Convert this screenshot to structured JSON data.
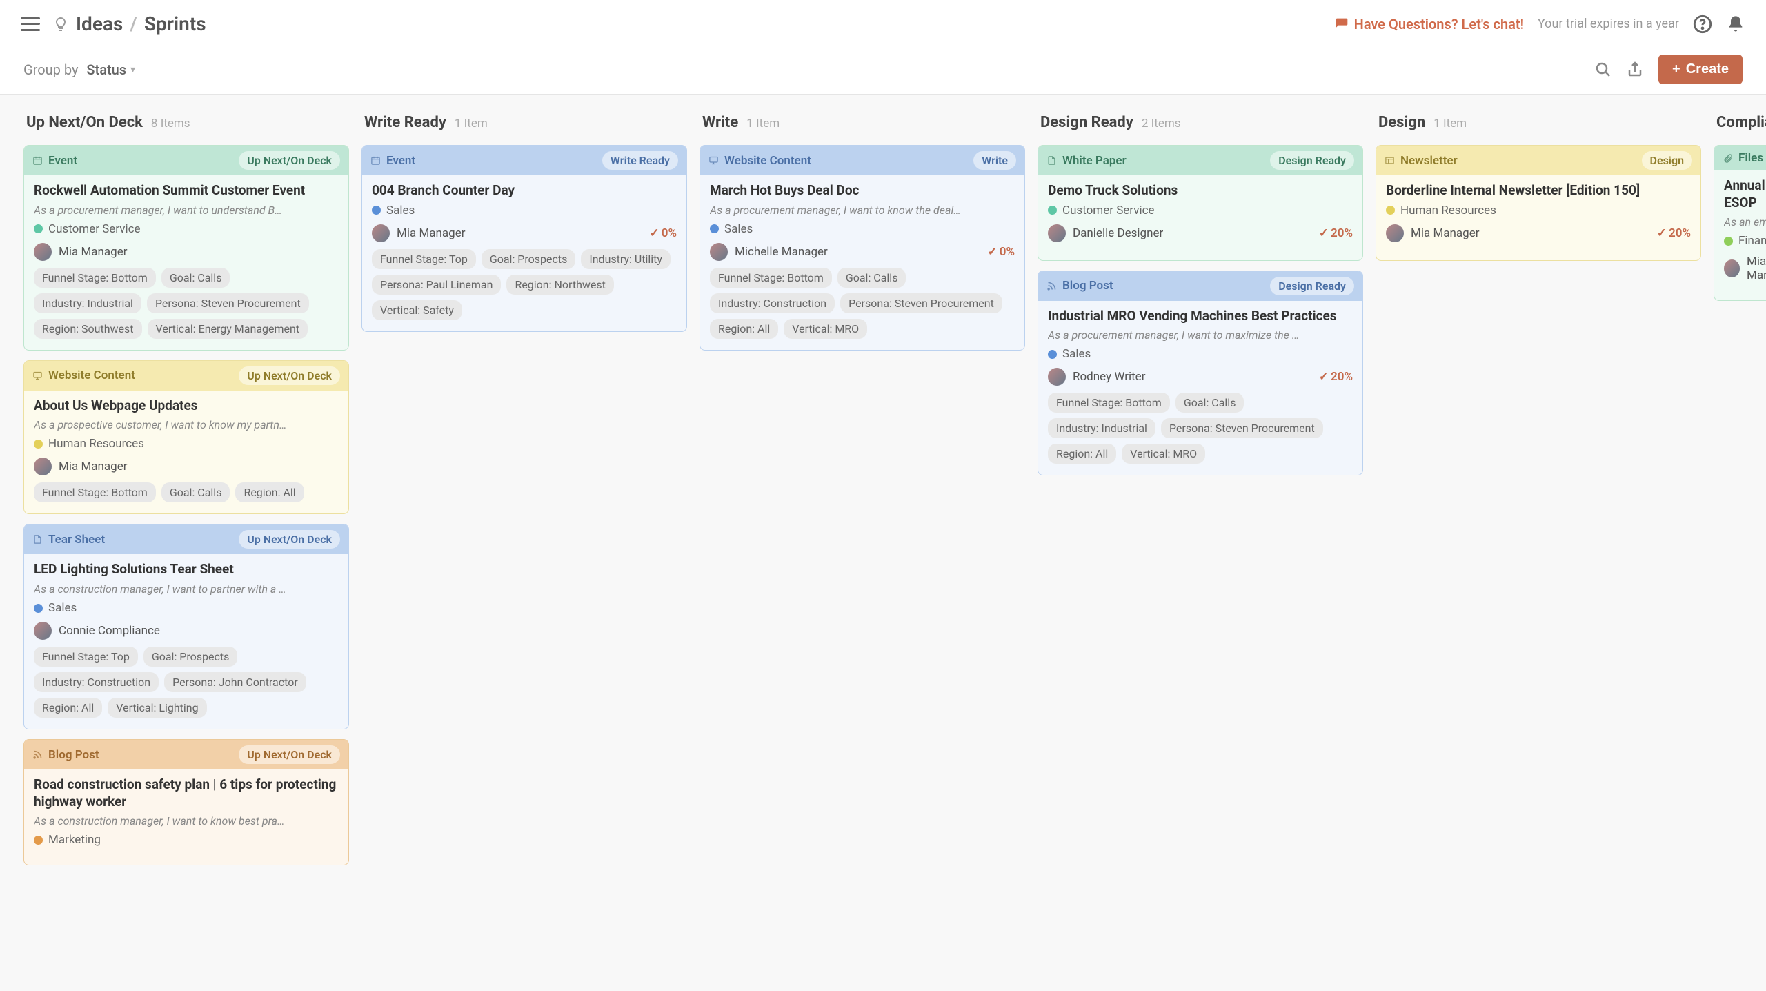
{
  "header": {
    "breadcrumb_root": "Ideas",
    "breadcrumb_current": "Sprints",
    "chat_text": "Have Questions? Let's chat!",
    "trial_text": "Your trial expires in a year"
  },
  "subheader": {
    "group_by_label": "Group by",
    "group_by_value": "Status",
    "create_label": "Create"
  },
  "columns": [
    {
      "title": "Up Next/On Deck",
      "count": "8 Items",
      "cards": [
        {
          "theme": "teal",
          "type_icon": "calendar-icon",
          "type_label": "Event",
          "status": "Up Next/On Deck",
          "title": "Rockwell Automation Summit Customer Event",
          "desc": "As a procurement manager, I want to understand B…",
          "initiative": {
            "color": "d-teal",
            "label": "Customer Service"
          },
          "assignee": "Mia Manager",
          "progress": null,
          "tags": [
            "Funnel Stage: Bottom",
            "Goal: Calls",
            "Industry: Industrial",
            "Persona: Steven Procurement",
            "Region: Southwest",
            "Vertical: Energy Management"
          ]
        },
        {
          "theme": "yellow",
          "type_icon": "monitor-icon",
          "type_label": "Website Content",
          "status": "Up Next/On Deck",
          "title": "About Us Webpage Updates",
          "desc": "As a prospective customer, I want to know my partn…",
          "initiative": {
            "color": "d-yellow",
            "label": "Human Resources"
          },
          "assignee": "Mia Manager",
          "progress": null,
          "tags": [
            "Funnel Stage: Bottom",
            "Goal: Calls",
            "Region: All"
          ]
        },
        {
          "theme": "blue",
          "type_icon": "doc-icon",
          "type_label": "Tear Sheet",
          "status": "Up Next/On Deck",
          "title": "LED Lighting Solutions Tear Sheet",
          "desc": "As a construction manager, I want to partner with a …",
          "initiative": {
            "color": "d-blue",
            "label": "Sales"
          },
          "assignee": "Connie Compliance",
          "progress": null,
          "tags": [
            "Funnel Stage: Top",
            "Goal: Prospects",
            "Industry: Construction",
            "Persona: John Contractor",
            "Region: All",
            "Vertical: Lighting"
          ]
        },
        {
          "theme": "orange",
          "type_icon": "rss-icon",
          "type_label": "Blog Post",
          "status": "Up Next/On Deck",
          "title": "Road construction safety plan | 6 tips for protecting highway worker",
          "desc": "As a construction manager, I want to know best pra…",
          "initiative": {
            "color": "d-orange",
            "label": "Marketing"
          },
          "assignee": null,
          "progress": null,
          "tags": []
        }
      ]
    },
    {
      "title": "Write Ready",
      "count": "1 Item",
      "cards": [
        {
          "theme": "blue",
          "type_icon": "calendar-icon",
          "type_label": "Event",
          "status": "Write Ready",
          "title": "004 Branch Counter Day",
          "desc": null,
          "initiative": {
            "color": "d-blue",
            "label": "Sales"
          },
          "assignee": "Mia Manager",
          "progress": "0%",
          "tags": [
            "Funnel Stage: Top",
            "Goal: Prospects",
            "Industry: Utility",
            "Persona: Paul Lineman",
            "Region: Northwest",
            "Vertical: Safety"
          ]
        }
      ]
    },
    {
      "title": "Write",
      "count": "1 Item",
      "cards": [
        {
          "theme": "blue",
          "type_icon": "monitor-icon",
          "type_label": "Website Content",
          "status": "Write",
          "title": "March Hot Buys Deal Doc",
          "desc": "As a procurement manager, I want to know the deal…",
          "initiative": {
            "color": "d-blue",
            "label": "Sales"
          },
          "assignee": "Michelle Manager",
          "progress": "0%",
          "tags": [
            "Funnel Stage: Bottom",
            "Goal: Calls",
            "Industry: Construction",
            "Persona: Steven Procurement",
            "Region: All",
            "Vertical: MRO"
          ]
        }
      ]
    },
    {
      "title": "Design Ready",
      "count": "2 Items",
      "cards": [
        {
          "theme": "teal",
          "type_icon": "doc-icon",
          "type_label": "White Paper",
          "status": "Design Ready",
          "title": "Demo Truck Solutions",
          "desc": null,
          "initiative": {
            "color": "d-teal",
            "label": "Customer Service"
          },
          "assignee": "Danielle Designer",
          "progress": "20%",
          "tags": []
        },
        {
          "theme": "blue",
          "type_icon": "rss-icon",
          "type_label": "Blog Post",
          "status": "Design Ready",
          "title": "Industrial MRO Vending Machines Best Practices",
          "desc": "As a procurement manager, I want to maximize the …",
          "initiative": {
            "color": "d-blue",
            "label": "Sales"
          },
          "assignee": "Rodney Writer",
          "progress": "20%",
          "tags": [
            "Funnel Stage: Bottom",
            "Goal: Calls",
            "Industry: Industrial",
            "Persona: Steven Procurement",
            "Region: All",
            "Vertical: MRO"
          ]
        }
      ]
    },
    {
      "title": "Design",
      "count": "1 Item",
      "cards": [
        {
          "theme": "yellow",
          "type_icon": "news-icon",
          "type_label": "Newsletter",
          "status": "Design",
          "title": "Borderline Internal Newsletter [Edition 150]",
          "desc": null,
          "initiative": {
            "color": "d-yellow",
            "label": "Human Resources"
          },
          "assignee": "Mia Manager",
          "progress": "20%",
          "tags": []
        }
      ]
    },
    {
      "title": "Compliance",
      "count": "",
      "narrow": true,
      "cards": [
        {
          "theme": "teal",
          "type_icon": "file-icon",
          "type_label": "Files",
          "status": "",
          "title": "Annual ESOP",
          "desc": "As an employee…",
          "initiative": {
            "color": "d-green",
            "label": "Finance"
          },
          "assignee": "Mia Manag",
          "progress": null,
          "tags": []
        }
      ]
    }
  ],
  "icons": {
    "calendar-icon": "📅",
    "monitor-icon": "🖵",
    "doc-icon": "📄",
    "rss-icon": "𖡡",
    "news-icon": "▦",
    "file-icon": "📎"
  }
}
